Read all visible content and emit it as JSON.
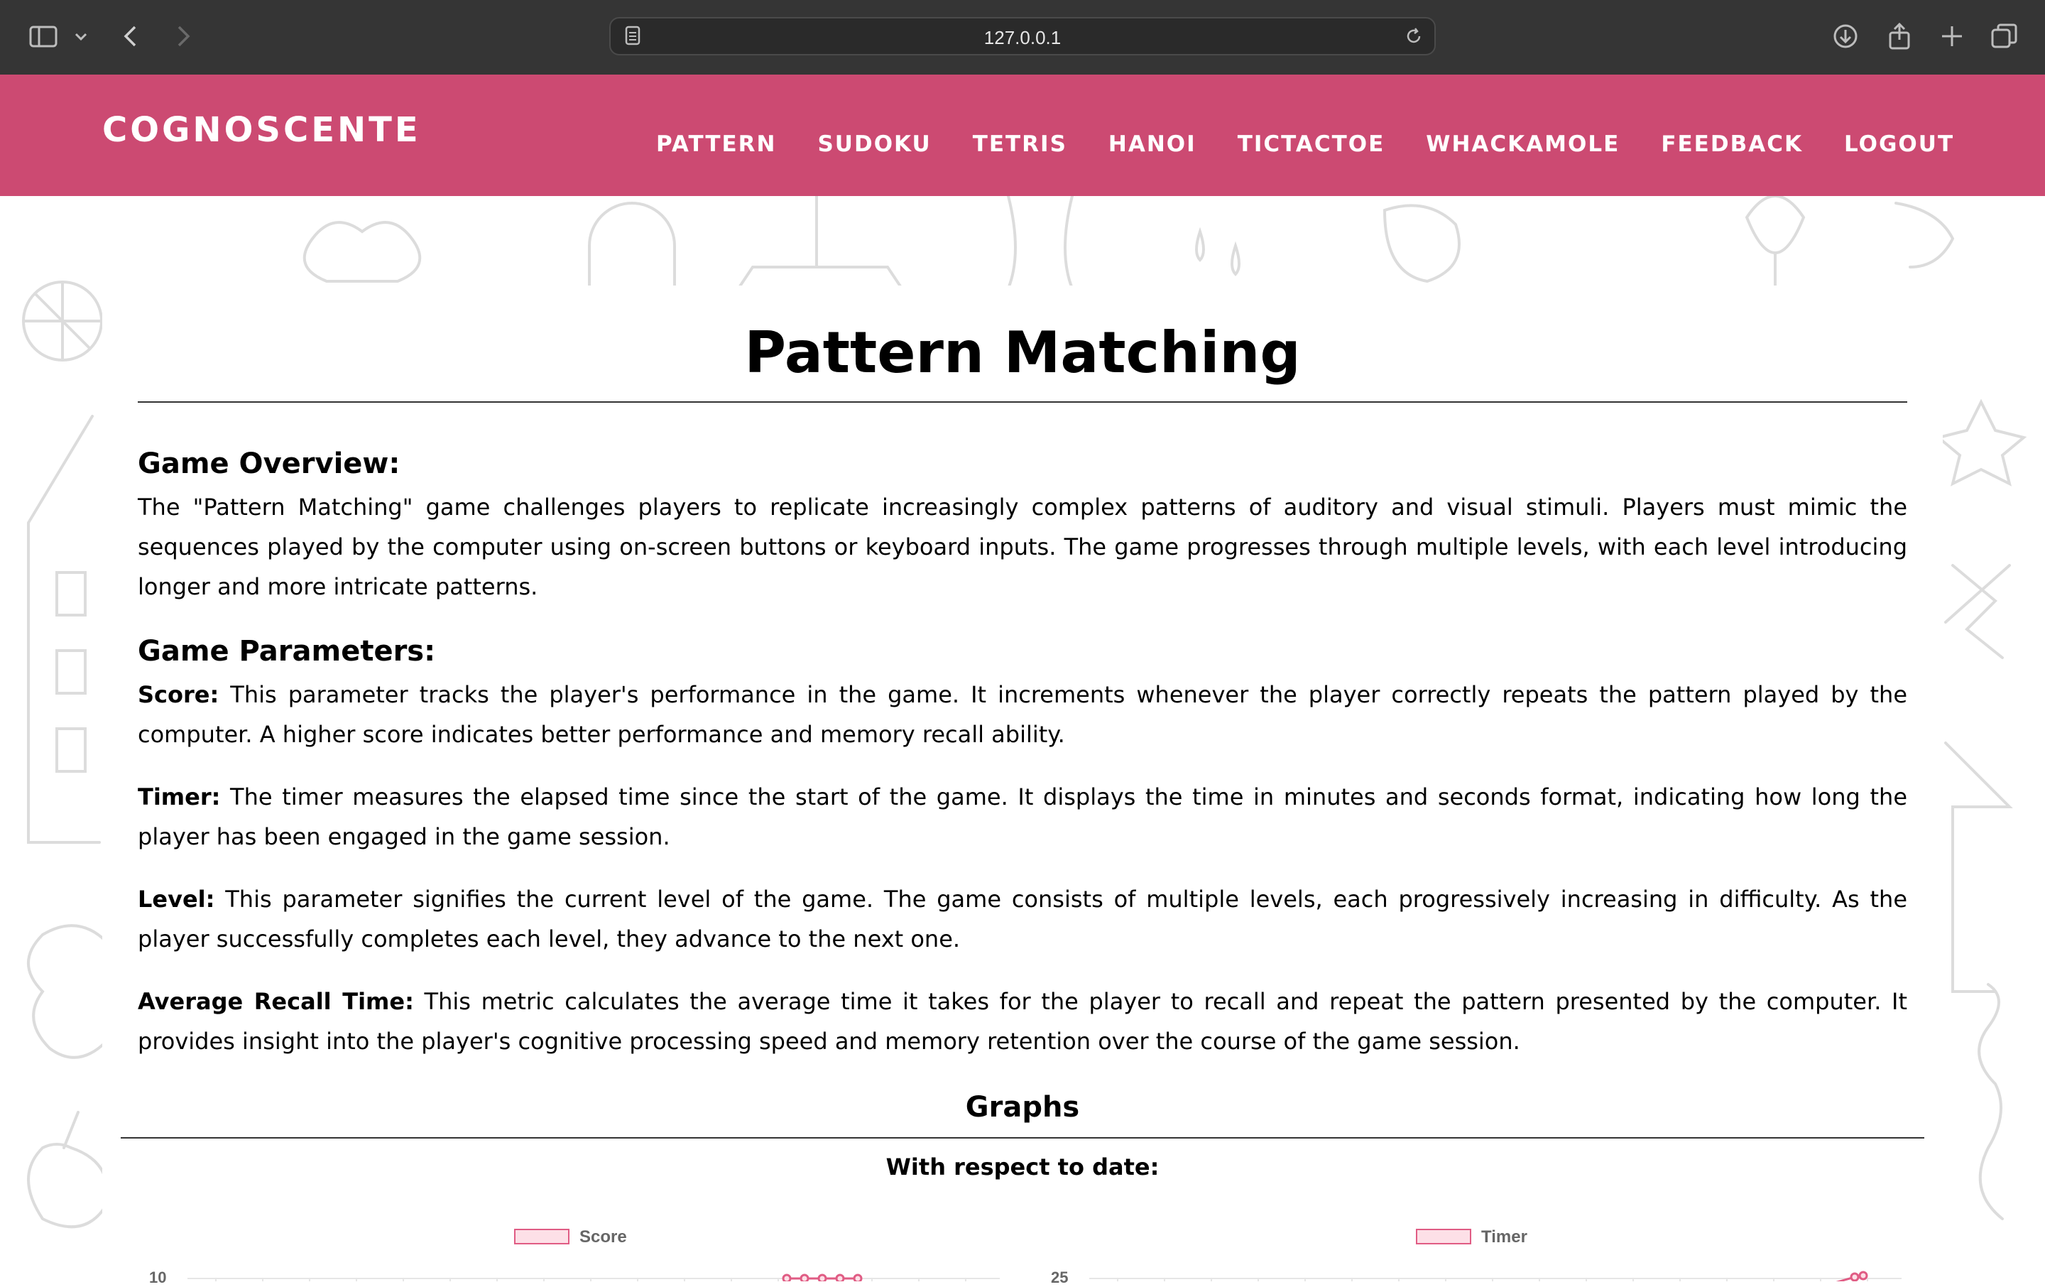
{
  "browser": {
    "url": "127.0.0.1",
    "icons": [
      "sidebar-icon",
      "chevron-down-icon",
      "back-icon",
      "forward-icon",
      "page-icon",
      "reload-icon",
      "download-icon",
      "share-icon",
      "new-tab-icon",
      "tabs-icon"
    ]
  },
  "header": {
    "brand": "COGNOSCENTE",
    "nav": [
      "PATTERN",
      "SUDOKU",
      "TETRIS",
      "HANOI",
      "TICTACTOE",
      "WHACKAMOLE",
      "FEEDBACK",
      "LOGOUT"
    ],
    "color": "#cc4a72"
  },
  "main": {
    "title": "Pattern Matching",
    "overview_heading": "Game Overview:",
    "overview_text": "The \"Pattern Matching\" game challenges players to replicate increasingly complex patterns of auditory and visual stimuli. Players must mimic the sequences played by the computer using on-screen buttons or keyboard inputs. The game progresses through multiple levels, with each level introducing longer and more intricate patterns.",
    "params_heading": "Game Parameters:",
    "params": [
      {
        "name": "Score:",
        "text": " This parameter tracks the player's performance in the game. It increments whenever the player correctly repeats the pattern played by the computer. A higher score indicates better performance and memory recall ability."
      },
      {
        "name": "Timer:",
        "text": " The timer measures the elapsed time since the start of the game. It displays the time in minutes and seconds format, indicating how long the player has been engaged in the game session."
      },
      {
        "name": "Level:",
        "text": " This parameter signifies the current level of the game. The game consists of multiple levels, each progressively increasing in difficulty. As the player successfully completes each level, they advance to the next one."
      },
      {
        "name": "Average Recall Time:",
        "text": " This metric calculates the average time it takes for the player to recall and repeat the pattern presented by the computer. It provides insight into the player's cognitive processing speed and memory retention over the course of the game session."
      }
    ],
    "graphs_heading": "Graphs",
    "date_heading": "With respect to date:"
  },
  "charts": [
    {
      "legend": "Score",
      "y_top_tick": "10",
      "color": "#e05c84"
    },
    {
      "legend": "Timer",
      "y_top_tick": "25",
      "color": "#e05c84"
    }
  ]
}
